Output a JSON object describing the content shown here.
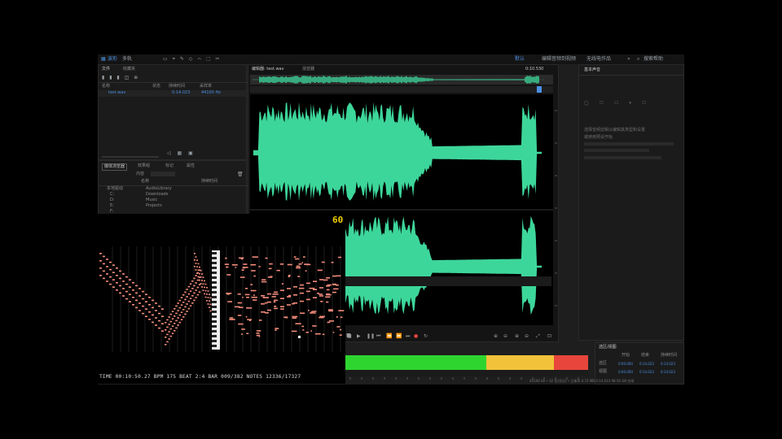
{
  "app": {
    "menu": {
      "mode_left_a": "波形",
      "mode_left_b": "多轨",
      "workspace_default": "默认",
      "workspace_edit": "编辑音频到视频",
      "workspace_radio": "无线电作品",
      "search_placeholder": "搜索帮助"
    },
    "files_panel": {
      "tab_files": "文件",
      "tab_favorites": "收藏夹",
      "col_name": "名称",
      "col_status": "状态",
      "col_duration": "持续时间",
      "col_samplerate": "采样率",
      "file_name": "test.wav",
      "file_duration": "0:14.023",
      "file_rate": "44100 Hz"
    },
    "media_panel": {
      "tab_media": "媒体浏览器",
      "tab_effects": "效果组",
      "tab_markers": "标记",
      "tab_props": "属性",
      "content_label": "内容",
      "col_name": "名称",
      "col_duration": "持续时间",
      "tree_items": [
        "本地驱动",
        "C:",
        "D:",
        "E:",
        "F:"
      ],
      "folder_items": [
        "AudioLibrary",
        "Downloads",
        "Music",
        "Projects"
      ]
    },
    "editor": {
      "tab_title": "编辑器: test.wav",
      "tab_mixer": "混音器",
      "timecode": "0:10.530"
    },
    "essential_panel": {
      "title": "基本声音",
      "hint": "选择音频剪辑以编辑其类型和设置",
      "hint2": "或使用预设开始"
    },
    "selection_panel": {
      "title": "选区/视图",
      "col_start": "开始",
      "col_end": "结束",
      "col_duration": "持续时间",
      "row_selection": "选区",
      "row_view": "视图",
      "sel_start": "0:00.000",
      "sel_end": "0:14.023",
      "sel_dur": "0:14.023",
      "view_start": "0:00.000",
      "view_end": "0:14.023",
      "view_dur": "0:14.023"
    },
    "status_bar": {
      "info": "44100 Hz • 32 位(浮点) • 立体声   4.72 MB   0:14.023   98.56 GB 空闲"
    }
  },
  "overlay": {
    "fps": "60",
    "status": "TIME 00:10:50.27 BPM 175 BEAT 2:4 BAR 009/382 NOTES 12336/17327"
  },
  "meter": {
    "colors": {
      "green": "#2fd52f",
      "yellow": "#f2c23a",
      "red": "#e8453c"
    },
    "green_end_fraction": 0.58,
    "yellow_end_fraction": 0.86
  },
  "colors": {
    "waveform": "#3dd69a",
    "notes": "#f08a7a",
    "accent": "#4a90e2"
  }
}
